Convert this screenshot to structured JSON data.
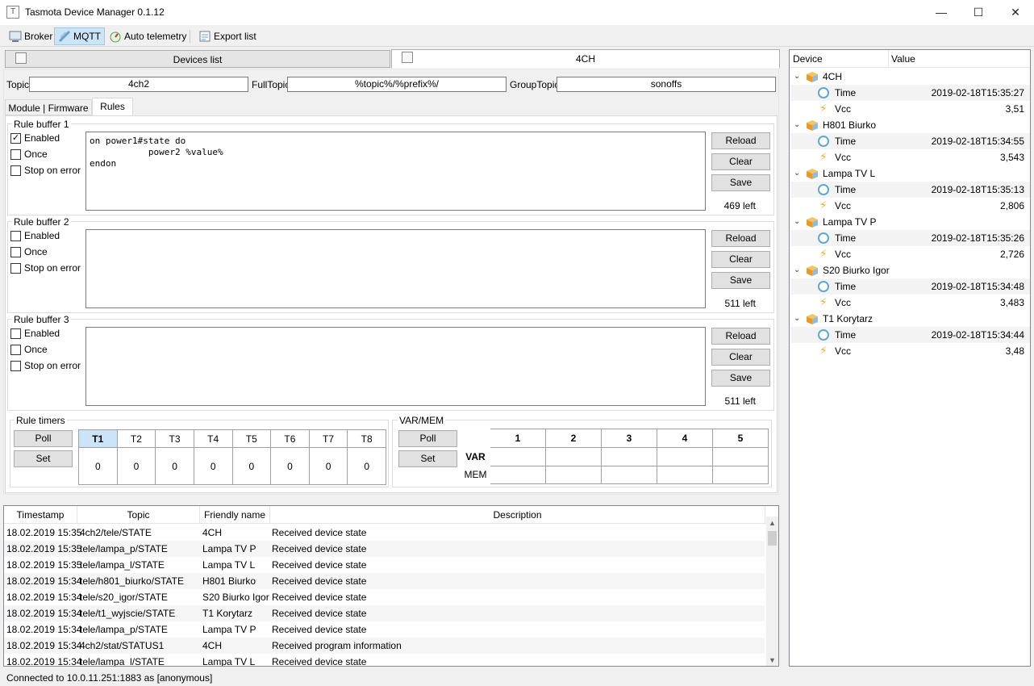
{
  "window": {
    "title": "Tasmota Device Manager 0.1.12",
    "minimize": "—",
    "maximize": "☐",
    "close": "✕"
  },
  "toolbar": {
    "broker": "Broker",
    "mqtt": "MQTT",
    "auto_telemetry": "Auto telemetry",
    "export_list": "Export list"
  },
  "main_tabs": {
    "devices_list": "Devices list",
    "device": "4CH"
  },
  "topics": {
    "topic_label": "Topic",
    "topic_value": "4ch2",
    "fulltopic_label": "FullTopic",
    "fulltopic_value": "%topic%/%prefix%/",
    "grouptopic_label": "GroupTopic",
    "grouptopic_value": "sonoffs"
  },
  "sub_tabs": {
    "module_firmware": "Module | Firmware",
    "rules": "Rules"
  },
  "rule_buffers": [
    {
      "title": "Rule buffer 1",
      "enabled_label": "Enabled",
      "enabled": true,
      "once_label": "Once",
      "stop_label": "Stop on error",
      "text": "on power1#state do\n           power2 %value%\nendon",
      "reload": "Reload",
      "clear": "Clear",
      "save": "Save",
      "left": "469 left"
    },
    {
      "title": "Rule buffer 2",
      "enabled_label": "Enabled",
      "enabled": false,
      "once_label": "Once",
      "stop_label": "Stop on error",
      "text": "",
      "reload": "Reload",
      "clear": "Clear",
      "save": "Save",
      "left": "511 left"
    },
    {
      "title": "Rule buffer 3",
      "enabled_label": "Enabled",
      "enabled": false,
      "once_label": "Once",
      "stop_label": "Stop on error",
      "text": "",
      "reload": "Reload",
      "clear": "Clear",
      "save": "Save",
      "left": "511 left"
    }
  ],
  "rule_timers": {
    "title": "Rule timers",
    "poll": "Poll",
    "set": "Set",
    "headers": [
      "T1",
      "T2",
      "T3",
      "T4",
      "T5",
      "T6",
      "T7",
      "T8"
    ],
    "values": [
      "0",
      "0",
      "0",
      "0",
      "0",
      "0",
      "0",
      "0"
    ]
  },
  "varmem": {
    "title": "VAR/MEM",
    "poll": "Poll",
    "set": "Set",
    "columns": [
      "1",
      "2",
      "3",
      "4",
      "5"
    ],
    "var_label": "VAR",
    "mem_label": "MEM"
  },
  "log": {
    "headers": [
      "Timestamp",
      "Topic",
      "Friendly name",
      "Description"
    ],
    "rows": [
      [
        "18.02.2019 15:35",
        "4ch2/tele/STATE",
        "4CH",
        "Received device state"
      ],
      [
        "18.02.2019 15:35",
        "tele/lampa_p/STATE",
        "Lampa TV P",
        "Received device state"
      ],
      [
        "18.02.2019 15:35",
        "tele/lampa_l/STATE",
        "Lampa TV L",
        "Received device state"
      ],
      [
        "18.02.2019 15:34",
        "tele/h801_biurko/STATE",
        "H801 Biurko",
        "Received device state"
      ],
      [
        "18.02.2019 15:34",
        "tele/s20_igor/STATE",
        "S20 Biurko Igor",
        "Received device state"
      ],
      [
        "18.02.2019 15:34",
        "tele/t1_wyjscie/STATE",
        "T1 Korytarz",
        "Received device state"
      ],
      [
        "18.02.2019 15:34",
        "tele/lampa_p/STATE",
        "Lampa TV P",
        "Received device state"
      ],
      [
        "18.02.2019 15:34",
        "4ch2/stat/STATUS1",
        "4CH",
        "Received program information"
      ],
      [
        "18.02.2019 15:34",
        "tele/lampa_l/STATE",
        "Lampa TV L",
        "Received device state"
      ]
    ]
  },
  "telemetry": {
    "headers": [
      "Device",
      "Value"
    ],
    "devices": [
      {
        "name": "4CH",
        "time_label": "Time",
        "time": "2019-02-18T15:35:27",
        "vcc_label": "Vcc",
        "vcc": "3,51"
      },
      {
        "name": "H801 Biurko",
        "time_label": "Time",
        "time": "2019-02-18T15:34:55",
        "vcc_label": "Vcc",
        "vcc": "3,543"
      },
      {
        "name": "Lampa TV L",
        "time_label": "Time",
        "time": "2019-02-18T15:35:13",
        "vcc_label": "Vcc",
        "vcc": "2,806"
      },
      {
        "name": "Lampa TV P",
        "time_label": "Time",
        "time": "2019-02-18T15:35:26",
        "vcc_label": "Vcc",
        "vcc": "2,726"
      },
      {
        "name": "S20 Biurko Igor",
        "time_label": "Time",
        "time": "2019-02-18T15:34:48",
        "vcc_label": "Vcc",
        "vcc": "3,483"
      },
      {
        "name": "T1 Korytarz",
        "time_label": "Time",
        "time": "2019-02-18T15:34:44",
        "vcc_label": "Vcc",
        "vcc": "3,48"
      }
    ]
  },
  "status": {
    "text": "Connected to 10.0.11.251:1883 as [anonymous]"
  }
}
